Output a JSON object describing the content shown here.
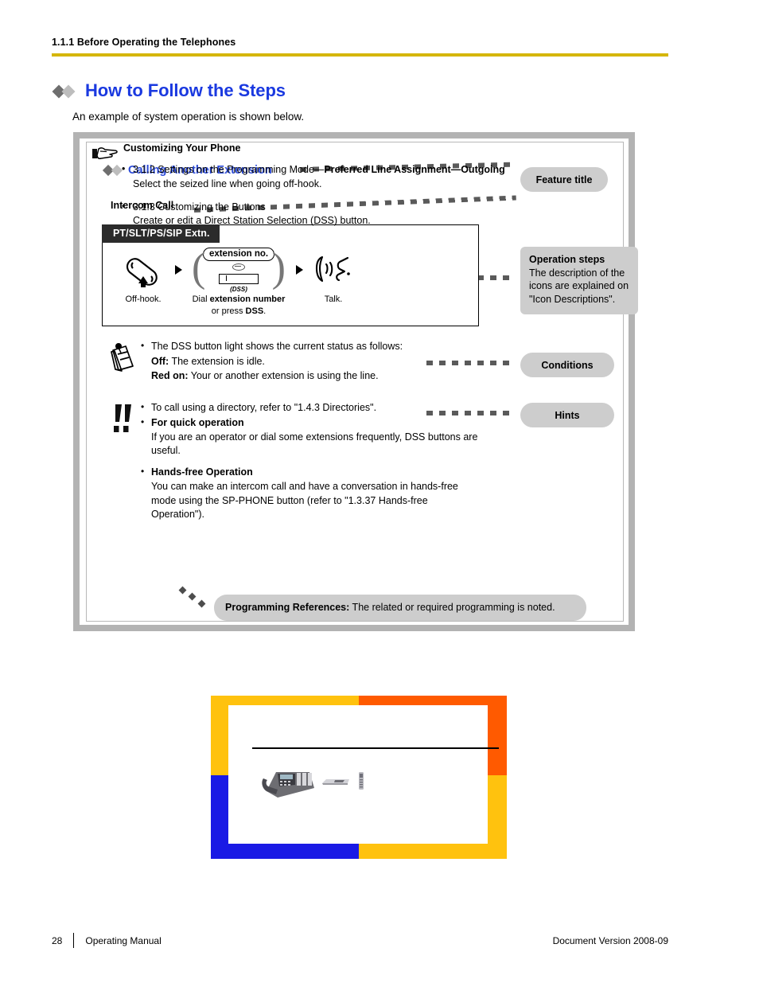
{
  "header": {
    "breadcrumb": "1.1.1 Before Operating the Telephones",
    "rule_color": "#d5b60a"
  },
  "section": {
    "title": "How to Follow the Steps",
    "title_color": "#1a39e0",
    "lead": "An example of system operation is shown below."
  },
  "example": {
    "feature_title": "Calling Another Extension",
    "subheading": "Intercom Call",
    "pt_header": "PT/SLT/PS/SIP Extn.",
    "steps": [
      {
        "art": "offhook-handset-icon",
        "caption_line1": "Off-hook.",
        "caption_line2": ""
      },
      {
        "art": "extension-number-keypad-icon",
        "pill_label": "extension no.",
        "or_label": "or",
        "dss_label": "(DSS)",
        "caption_line1": "Dial extension number",
        "caption_line1_plain": "Dial ",
        "caption_line1_bold": "extension number",
        "caption_line2_plain": "or press ",
        "caption_line2_bold": "DSS",
        "caption_line2_tail": "."
      },
      {
        "art": "talk-handset-icon",
        "caption_line1": "Talk.",
        "caption_line2": ""
      }
    ],
    "conditions": {
      "icon": "notepad-icon",
      "bullet": "The DSS button light shows the current status as follows:",
      "off_label": "Off:",
      "off_text": " The extension is idle.",
      "red_label": "Red on:",
      "red_text": " Your or another extension is using the line."
    },
    "hints": {
      "icon": "double-exclamation-icon",
      "item1": "To call using a directory, refer to \"1.4.3 Directories\".",
      "item2_title": "For quick operation",
      "item2_text": "If you are an operator or dial some extensions frequently, DSS buttons are useful.",
      "item3_title": "Hands-free Operation",
      "item3_text": "You can make an intercom call and have a conversation in hands-free mode using the SP-PHONE button (refer to \"1.3.37 Hands-free Operation\")."
    },
    "customize": {
      "icon": "pointing-hand-icon",
      "title": "Customizing Your Phone",
      "item1_plain": "3.1.2 Settings on the Programming Mode—",
      "item1_bold": "Preferred Line Assignment—Outgoing",
      "item1_sub": "Select the seized line when going off-hook.",
      "item2_plain": "3.1.3 Customizing the Buttons",
      "item2_sub": "Create or edit a Direct Station Selection (DSS) button."
    },
    "callouts": {
      "feature_title": "Feature title",
      "operation_steps_title": "Operation steps",
      "operation_steps_body": "The description of the icons are explained on \"Icon Descriptions\".",
      "conditions": "Conditions",
      "hints": "Hints",
      "programming_refs_label": "Programming References:",
      "programming_refs_text": " The related or required programming is noted."
    }
  },
  "figure": {
    "name": "product-photo-panel",
    "colors": {
      "yellow": "#ffc20e",
      "orange": "#ff5a00",
      "blue": "#1a1ae5"
    }
  },
  "footer": {
    "page_number": "28",
    "manual": "Operating Manual",
    "version": "Document Version  2008-09"
  }
}
